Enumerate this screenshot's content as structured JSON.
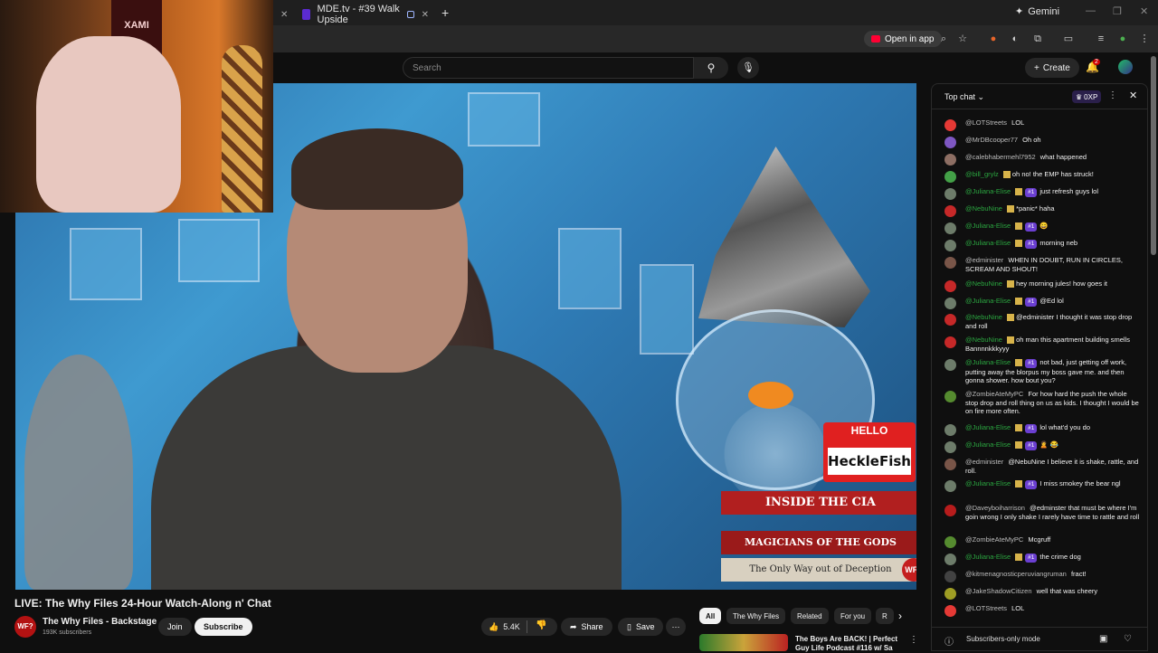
{
  "browser": {
    "tab_title": "MDE.tv - #39 Walk Upside",
    "gemini_label": "Gemini",
    "open_in_app": "Open in app",
    "new_tab": "+",
    "window_controls": [
      "—",
      "❐",
      "✕"
    ]
  },
  "youtube": {
    "search_placeholder": "Search",
    "create_label": "Create",
    "notification_count": "2"
  },
  "video": {
    "title": "LIVE: The Why Files 24-Hour Watch-Along n' Chat",
    "name_tag_hello": "HELLO",
    "name_tag_name": "HeckleFish",
    "books": [
      "INSIDE THE CIA",
      "MAGICIANS OF THE GODS",
      "The Only Way out of Deception"
    ],
    "poster_text": "XAMI",
    "logo": "WF?"
  },
  "channel": {
    "name": "The Why Files - Backstage",
    "subscribers": "193K subscribers",
    "avatar_text": "WF?",
    "join_label": "Join",
    "subscribe_label": "Subscribe"
  },
  "actions": {
    "likes": "5.4K",
    "share": "Share",
    "save": "Save"
  },
  "chips": [
    "All",
    "The Why Files",
    "Related",
    "For you",
    "R"
  ],
  "recommendation": {
    "title": "The Boys Are BACK! | Perfect Guy Life Podcast #116 w/ Sa"
  },
  "chat": {
    "mode": "Top chat",
    "xp": "0XP",
    "footer": "Subscribers-only mode",
    "messages": [
      {
        "author": "@LOTStreets",
        "text": "LOL",
        "color": "#e53935",
        "member": false,
        "badge": ""
      },
      {
        "author": "@MrDBcooper77",
        "text": "Oh oh",
        "color": "#7e57c2",
        "member": false,
        "badge": ""
      },
      {
        "author": "@calebhabermehl7952",
        "text": "what happened",
        "color": "#8d6e63",
        "member": false,
        "badge": ""
      },
      {
        "author": "@bill_grylz",
        "text": "oh no! the EMP has struck!",
        "color": "#43a047",
        "member": true,
        "badge": ""
      },
      {
        "author": "@Juliana-Elise",
        "text": "just refresh guys lol",
        "color": "#6d7c6a",
        "member": true,
        "badge": "#1"
      },
      {
        "author": "@NebuNine",
        "text": "*panic* haha",
        "color": "#c62828",
        "member": true,
        "badge": ""
      },
      {
        "author": "@Juliana-Elise",
        "text": "😄",
        "color": "#6d7c6a",
        "member": true,
        "badge": "#1"
      },
      {
        "author": "@Juliana-Elise",
        "text": "morning neb",
        "color": "#6d7c6a",
        "member": true,
        "badge": "#1"
      },
      {
        "author": "@edminister",
        "text": "WHEN IN DOUBT, RUN IN CIRCLES, SCREAM AND SHOUT!",
        "color": "#795548",
        "member": false,
        "badge": ""
      },
      {
        "author": "@NebuNine",
        "text": "hey morning jules! how goes it",
        "color": "#c62828",
        "member": true,
        "badge": ""
      },
      {
        "author": "@Juliana-Elise",
        "text": "@Ed lol",
        "color": "#6d7c6a",
        "member": true,
        "badge": "#1"
      },
      {
        "author": "@NebuNine",
        "text": "@edminister I thought it was stop drop and roll",
        "color": "#c62828",
        "member": true,
        "badge": ""
      },
      {
        "author": "@NebuNine",
        "text": "oh man this apartment building smells Bannnnkkkyyy",
        "color": "#c62828",
        "member": true,
        "badge": ""
      },
      {
        "author": "@Juliana-Elise",
        "text": "not bad, just getting off work, putting away the blorpus my boss gave me. and then gonna shower. how bout you?",
        "color": "#6d7c6a",
        "member": true,
        "badge": "#1"
      },
      {
        "author": "@ZombieAteMyPC",
        "text": "For how hard the push the whole stop drop and roll thing on us as kids. I thought I would be on fire more often.",
        "color": "#558b2f",
        "member": false,
        "badge": ""
      },
      {
        "author": "@Juliana-Elise",
        "text": "lol what'd you do",
        "color": "#6d7c6a",
        "member": true,
        "badge": "#1"
      },
      {
        "author": "@Juliana-Elise",
        "text": "🙎 😂",
        "color": "#6d7c6a",
        "member": true,
        "badge": "#1"
      },
      {
        "author": "@edminister",
        "text": "@NebuNine I believe it is shake, rattle, and roll.",
        "color": "#795548",
        "member": false,
        "badge": ""
      },
      {
        "author": "@Juliana-Elise",
        "text": "I miss smokey the bear ngl",
        "color": "#6d7c6a",
        "member": true,
        "badge": "#1"
      },
      {
        "author": "@Daveyboiharrison",
        "text": "@edminster that must be where I'm goin wrong I only shake I rarely have time to rattle and roll",
        "color": "#b71c1c",
        "member": false,
        "badge": ""
      },
      {
        "author": "@ZombieAteMyPC",
        "text": "Mcgruff",
        "color": "#558b2f",
        "member": false,
        "badge": ""
      },
      {
        "author": "@Juliana-Elise",
        "text": "the crime dog",
        "color": "#6d7c6a",
        "member": true,
        "badge": "#1"
      },
      {
        "author": "@kitmenagnosticperuviangruman",
        "text": "fract!",
        "color": "#424242",
        "member": false,
        "badge": ""
      },
      {
        "author": "@JakeShadowCitizen",
        "text": "well that was cheery",
        "color": "#9e9d24",
        "member": false,
        "badge": ""
      },
      {
        "author": "@LOTStreets",
        "text": "LOL",
        "color": "#e53935",
        "member": false,
        "badge": ""
      }
    ]
  }
}
